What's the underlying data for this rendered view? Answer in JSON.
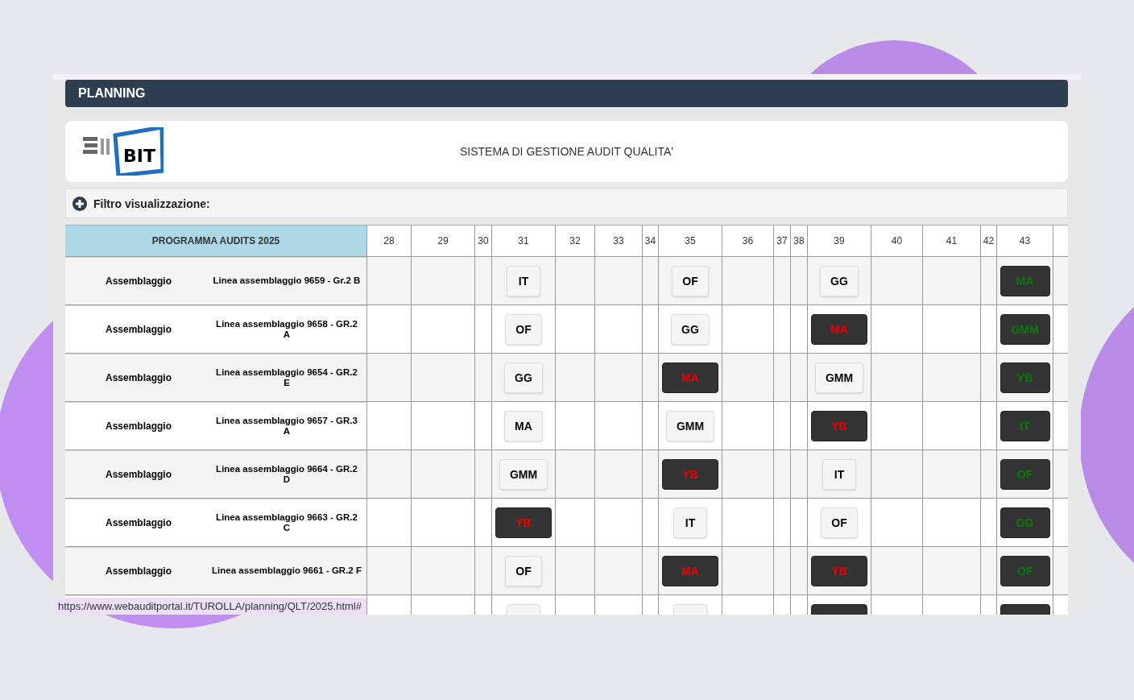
{
  "header": {
    "title": "PLANNING"
  },
  "logo": {
    "text": "BIT"
  },
  "system_title": "SISTEMA DI GESTIONE AUDIT QUALITA'",
  "filter": {
    "label": "Filtro visualizzazione:",
    "expanded": false
  },
  "table": {
    "title": "PROGRAMMA AUDITS 2025",
    "weeks": [
      "28",
      "29",
      "30",
      "31",
      "32",
      "33",
      "34",
      "35",
      "36",
      "37",
      "38",
      "39",
      "40",
      "41",
      "42",
      "43"
    ],
    "rows": [
      {
        "area": "Assemblaggio",
        "line": "Linea assemblaggio 9659 - Gr.2 B",
        "chips": [
          {
            "label": "IT",
            "kind": "light"
          },
          {
            "label": "OF",
            "kind": "light"
          },
          {
            "label": "GG",
            "kind": "light"
          },
          {
            "label": "MA",
            "kind": "green"
          }
        ]
      },
      {
        "area": "Assemblaggio",
        "line": "Linea assemblaggio 9658 - GR.2 A",
        "chips": [
          {
            "label": "OF",
            "kind": "light"
          },
          {
            "label": "GG",
            "kind": "light"
          },
          {
            "label": "MA",
            "kind": "red"
          },
          {
            "label": "GMM",
            "kind": "green"
          }
        ]
      },
      {
        "area": "Assemblaggio",
        "line": "Linea assemblaggio 9654 - GR.2 E",
        "chips": [
          {
            "label": "GG",
            "kind": "light"
          },
          {
            "label": "MA",
            "kind": "red"
          },
          {
            "label": "GMM",
            "kind": "light"
          },
          {
            "label": "YB",
            "kind": "green"
          }
        ]
      },
      {
        "area": "Assemblaggio",
        "line": "Linea assemblaggio 9657 - GR.3 A",
        "chips": [
          {
            "label": "MA",
            "kind": "light"
          },
          {
            "label": "GMM",
            "kind": "light"
          },
          {
            "label": "YB",
            "kind": "red"
          },
          {
            "label": "IT",
            "kind": "green"
          }
        ]
      },
      {
        "area": "Assemblaggio",
        "line": "Linea assemblaggio 9664 - GR.2 D",
        "chips": [
          {
            "label": "GMM",
            "kind": "light"
          },
          {
            "label": "YB",
            "kind": "red"
          },
          {
            "label": "IT",
            "kind": "light"
          },
          {
            "label": "OF",
            "kind": "green"
          }
        ]
      },
      {
        "area": "Assemblaggio",
        "line": "Linea assemblaggio 9663 - GR.2 C",
        "chips": [
          {
            "label": "YB",
            "kind": "red"
          },
          {
            "label": "IT",
            "kind": "light"
          },
          {
            "label": "OF",
            "kind": "light"
          },
          {
            "label": "GG",
            "kind": "green"
          }
        ]
      },
      {
        "area": "Assemblaggio",
        "line": "Linea assemblaggio 9661 - GR.2 F",
        "chips": [
          {
            "label": "OF",
            "kind": "light"
          },
          {
            "label": "MA",
            "kind": "red"
          },
          {
            "label": "YB",
            "kind": "red"
          },
          {
            "label": "OF",
            "kind": "green"
          }
        ]
      },
      {
        "chips": [
          {
            "kind": "light"
          },
          {
            "kind": "light"
          },
          {
            "kind": "red"
          },
          {
            "kind": "green"
          }
        ]
      }
    ]
  },
  "status_url": "https://www.webauditportal.it/TUROLLA/planning/QLT/2025.html#"
}
